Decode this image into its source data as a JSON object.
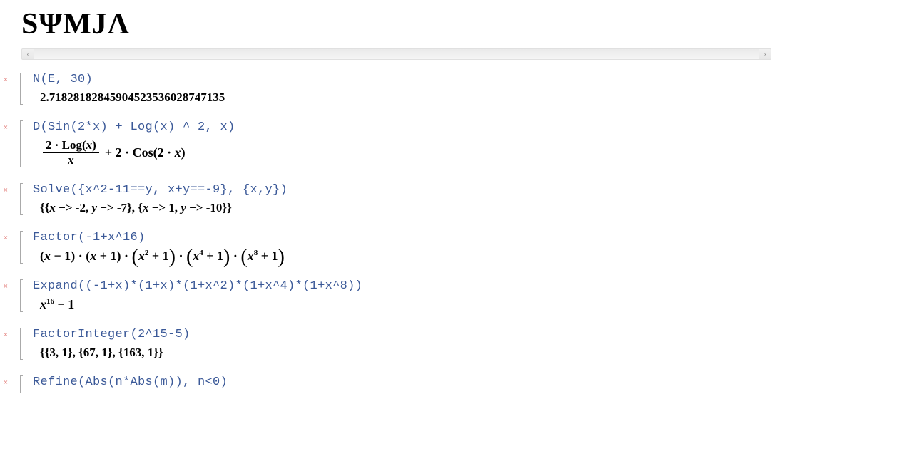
{
  "logo": "SΨMJΛ",
  "cells": [
    {
      "input": "N(E, 30)",
      "output_plain": "2.71828182845904523536028747135"
    },
    {
      "input": "D(Sin(2*x) + Log(x) ^ 2, x)",
      "output_math": {
        "type": "derivative",
        "frac_num": "2 · Log(x)",
        "frac_den": "x",
        "rest": " + 2 · Cos(2 · x)"
      }
    },
    {
      "input": "Solve({x^2-11==y, x+y==-9}, {x,y})",
      "output_plain": "{{x −> -2, y −> -7}, {x −> 1, y −> -10}}"
    },
    {
      "input": "Factor(-1+x^16)",
      "output_math": {
        "type": "factor",
        "terms": [
          "(x − 1)",
          "(x + 1)",
          "(x² + 1)",
          "(x⁴ + 1)",
          "(x⁸ + 1)"
        ]
      }
    },
    {
      "input": "Expand((-1+x)*(1+x)*(1+x^2)*(1+x^4)*(1+x^8))",
      "output_math": {
        "type": "expand",
        "expr": "x¹⁶ − 1"
      }
    },
    {
      "input": "FactorInteger(2^15-5)",
      "output_plain": "{{3, 1}, {67, 1}, {163, 1}}"
    },
    {
      "input": "Refine(Abs(n*Abs(m)), n<0)",
      "output_plain": null
    }
  ],
  "icons": {
    "delete": "×",
    "scroll_left": "‹",
    "scroll_right": "›"
  }
}
